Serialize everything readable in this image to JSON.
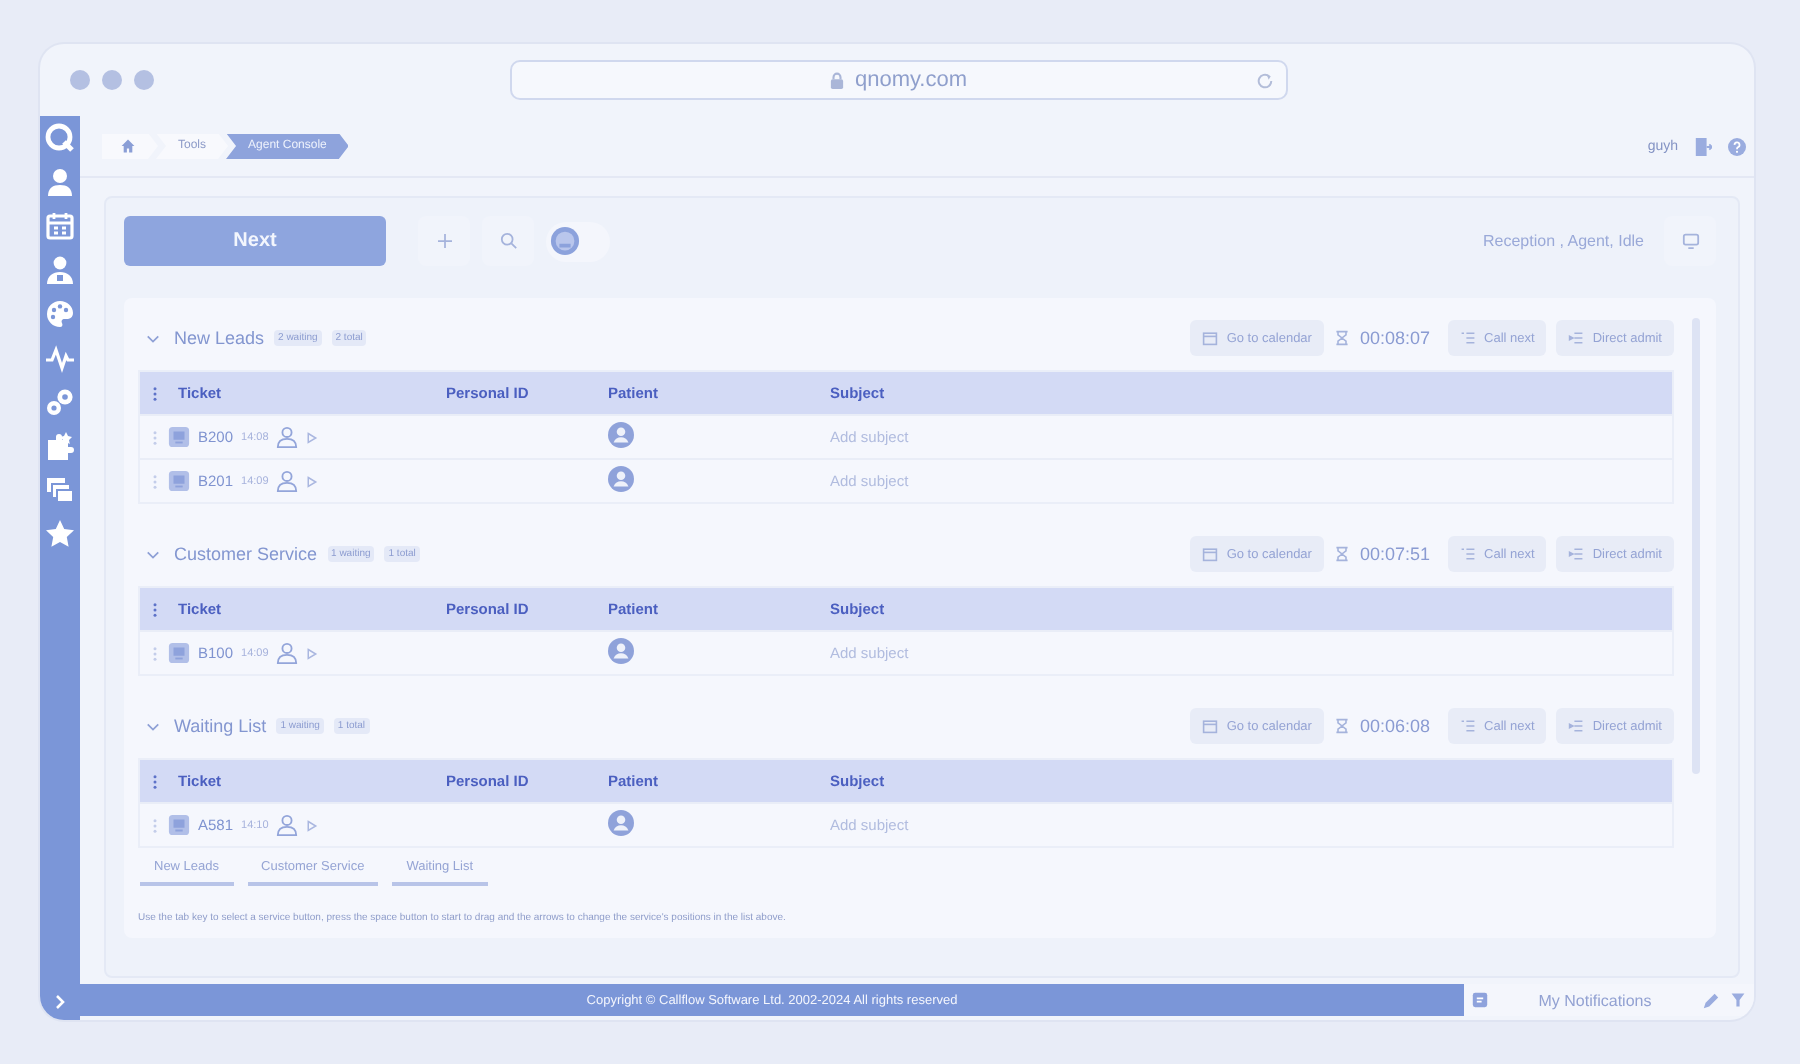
{
  "browser": {
    "url": "qnomy.com"
  },
  "breadcrumbs": [
    {
      "label": "Tools",
      "selected": false
    },
    {
      "label": "Agent Console",
      "selected": true
    }
  ],
  "header": {
    "user": "guyh"
  },
  "toolbar": {
    "next_button": "Next",
    "toggle": {
      "on": false
    },
    "status": "Reception , Agent, Idle"
  },
  "sections": [
    {
      "name": "New Leads",
      "waiting": "2 waiting",
      "total": "2 total",
      "calendar_button": "Go to calendar",
      "timer": "00:08:07",
      "call_next_button": "Call next",
      "direct_admit_button": "Direct admit",
      "columns": [
        "Ticket",
        "Personal ID",
        "Patient",
        "Subject"
      ],
      "rows": [
        {
          "ticket": "B200",
          "time": "14:08",
          "subject": "Add subject"
        },
        {
          "ticket": "B201",
          "time": "14:09",
          "subject": "Add subject"
        }
      ]
    },
    {
      "name": "Customer Service",
      "waiting": "1 waiting",
      "total": "1 total",
      "calendar_button": "Go to calendar",
      "timer": "00:07:51",
      "call_next_button": "Call next",
      "direct_admit_button": "Direct admit",
      "columns": [
        "Ticket",
        "Personal ID",
        "Patient",
        "Subject"
      ],
      "rows": [
        {
          "ticket": "B100",
          "time": "14:09",
          "subject": "Add subject"
        }
      ]
    },
    {
      "name": "Waiting List",
      "waiting": "1 waiting",
      "total": "1 total",
      "calendar_button": "Go to calendar",
      "timer": "00:06:08",
      "call_next_button": "Call next",
      "direct_admit_button": "Direct admit",
      "columns": [
        "Ticket",
        "Personal ID",
        "Patient",
        "Subject"
      ],
      "rows": [
        {
          "ticket": "A581",
          "time": "14:10",
          "subject": "Add subject"
        }
      ]
    }
  ],
  "service_tabs": [
    "New Leads",
    "Customer Service",
    "Waiting List"
  ],
  "hint": "Use the tab key to select a service button, press the space button to start to drag and the arrows to change the service's positions in the list above.",
  "footer": {
    "copyright": "Copyright © Callflow Software Ltd. 2002-2024 All rights reserved",
    "notifications": "My Notifications"
  }
}
